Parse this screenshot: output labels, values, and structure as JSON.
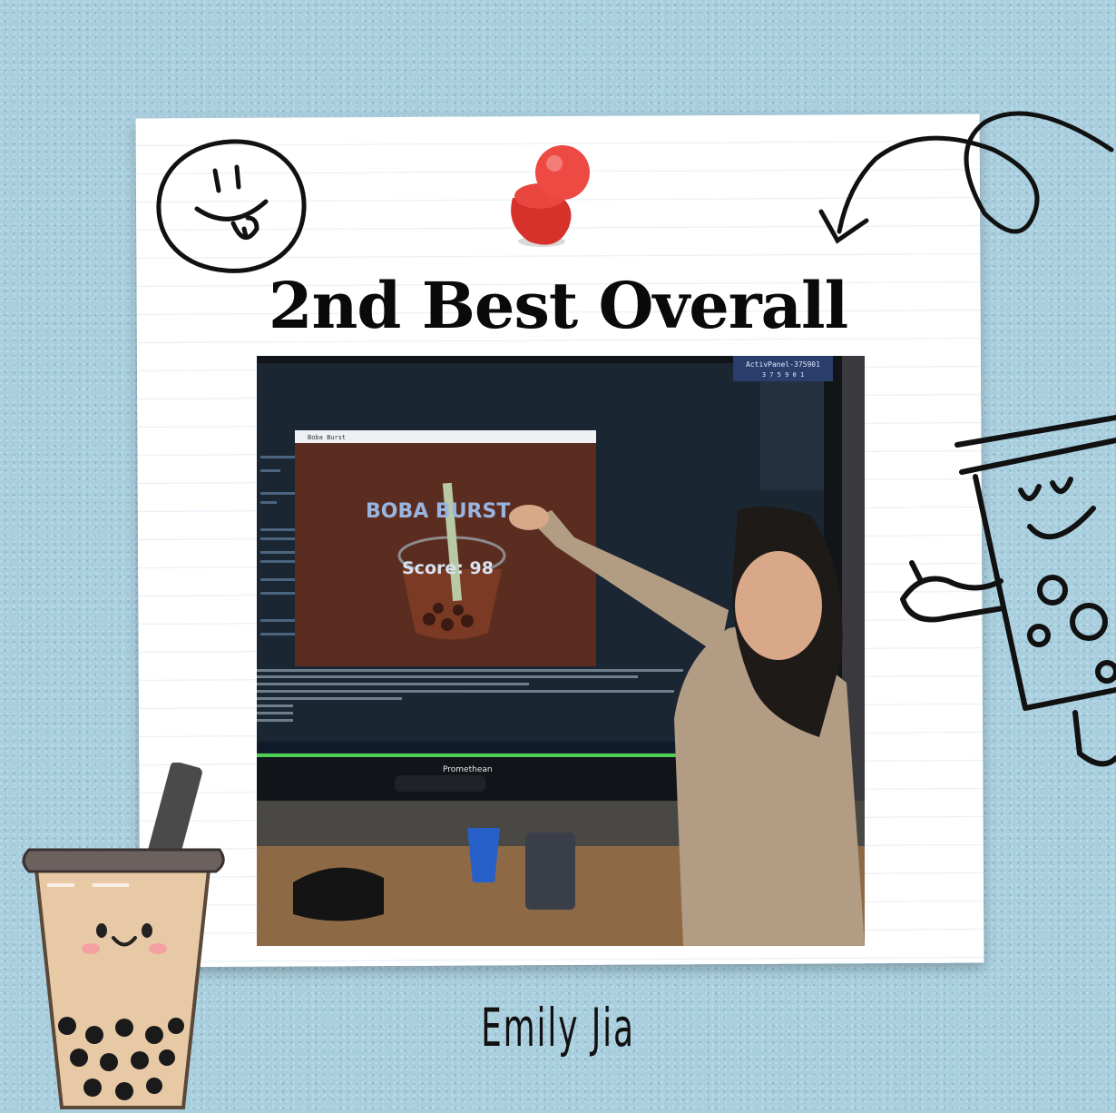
{
  "title": "2nd Best Overall",
  "name": "Emily Jia",
  "photo": {
    "game_window_title": "Boba Burst",
    "game_heading": "BOBA BURST",
    "game_score": "Score: 98",
    "panel_label": "ActivPanel-375901",
    "panel_code": "3 7 5 9 0 1",
    "brand": "Promethean"
  },
  "colors": {
    "background": "#a9cfdf",
    "card": "#ffffff",
    "pin": "#e8463f"
  }
}
